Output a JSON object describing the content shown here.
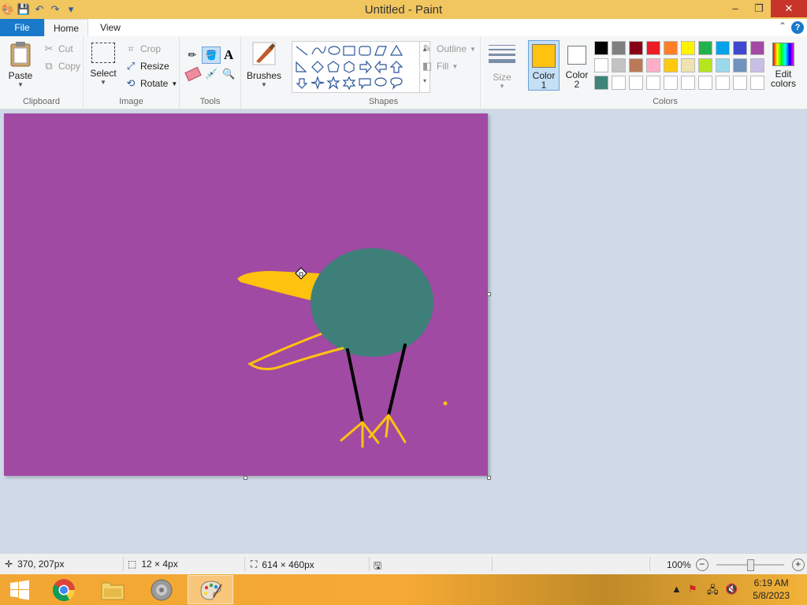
{
  "window": {
    "title": "Untitled - Paint",
    "controls": {
      "minimize": "–",
      "restore": "❐",
      "close": "✕"
    }
  },
  "tabs": {
    "file": "File",
    "home": "Home",
    "view": "View",
    "help": "?"
  },
  "clipboard": {
    "paste": "Paste",
    "cut": "Cut",
    "copy": "Copy",
    "group": "Clipboard"
  },
  "image": {
    "select": "Select",
    "crop": "Crop",
    "resize": "Resize",
    "rotate": "Rotate",
    "group": "Image"
  },
  "tools": {
    "group": "Tools",
    "text_tool": "A"
  },
  "brushes": {
    "label": "Brushes"
  },
  "shapes": {
    "outline": "Outline",
    "fill": "Fill",
    "group": "Shapes"
  },
  "size": {
    "label": "Size"
  },
  "colors": {
    "color1_label": "Color",
    "color1_num": "1",
    "color2_label": "Color",
    "color2_num": "2",
    "edit_label": "Edit",
    "edit_label2": "colors",
    "group": "Colors",
    "color1_value": "#ffc20e",
    "color2_value": "#ffffff",
    "palette_row1": [
      "#000000",
      "#7f7f7f",
      "#880015",
      "#ed1c24",
      "#ff7f27",
      "#fff200",
      "#22b14c",
      "#00a2e8",
      "#3f48cc",
      "#a349a4"
    ],
    "palette_row2": [
      "#ffffff",
      "#c3c3c3",
      "#b97a57",
      "#ffaec9",
      "#ffc90e",
      "#efe4b0",
      "#b5e61d",
      "#99d9ea",
      "#7092be",
      "#c8bfe7"
    ],
    "palette_row3": [
      "#3e8479",
      "#ffffff",
      "#ffffff",
      "#ffffff",
      "#ffffff",
      "#ffffff",
      "#ffffff",
      "#ffffff",
      "#ffffff",
      "#ffffff"
    ]
  },
  "canvas": {
    "background": "#a14aa3",
    "body_color": "#3e7f7a",
    "beak_color": "#ffc20e",
    "leg_color": "#000000"
  },
  "status": {
    "cursor_pos": "370, 207px",
    "selection_size": "12 × 4px",
    "image_size": "614 × 460px",
    "zoom": "100%",
    "zoom_out": "−",
    "zoom_in": "+"
  },
  "taskbar": {
    "time": "6:19 AM",
    "date": "5/8/2023"
  }
}
